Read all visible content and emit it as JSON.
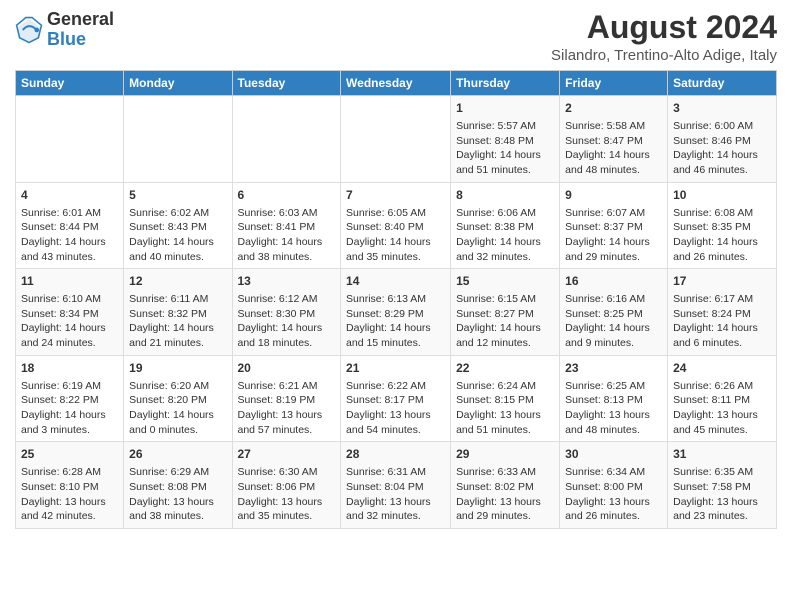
{
  "header": {
    "logo_line1": "General",
    "logo_line2": "Blue",
    "title": "August 2024",
    "subtitle": "Silandro, Trentino-Alto Adige, Italy"
  },
  "columns": [
    "Sunday",
    "Monday",
    "Tuesday",
    "Wednesday",
    "Thursday",
    "Friday",
    "Saturday"
  ],
  "weeks": [
    [
      {
        "day": "",
        "content": ""
      },
      {
        "day": "",
        "content": ""
      },
      {
        "day": "",
        "content": ""
      },
      {
        "day": "",
        "content": ""
      },
      {
        "day": "1",
        "content": "Sunrise: 5:57 AM\nSunset: 8:48 PM\nDaylight: 14 hours and 51 minutes."
      },
      {
        "day": "2",
        "content": "Sunrise: 5:58 AM\nSunset: 8:47 PM\nDaylight: 14 hours and 48 minutes."
      },
      {
        "day": "3",
        "content": "Sunrise: 6:00 AM\nSunset: 8:46 PM\nDaylight: 14 hours and 46 minutes."
      }
    ],
    [
      {
        "day": "4",
        "content": "Sunrise: 6:01 AM\nSunset: 8:44 PM\nDaylight: 14 hours and 43 minutes."
      },
      {
        "day": "5",
        "content": "Sunrise: 6:02 AM\nSunset: 8:43 PM\nDaylight: 14 hours and 40 minutes."
      },
      {
        "day": "6",
        "content": "Sunrise: 6:03 AM\nSunset: 8:41 PM\nDaylight: 14 hours and 38 minutes."
      },
      {
        "day": "7",
        "content": "Sunrise: 6:05 AM\nSunset: 8:40 PM\nDaylight: 14 hours and 35 minutes."
      },
      {
        "day": "8",
        "content": "Sunrise: 6:06 AM\nSunset: 8:38 PM\nDaylight: 14 hours and 32 minutes."
      },
      {
        "day": "9",
        "content": "Sunrise: 6:07 AM\nSunset: 8:37 PM\nDaylight: 14 hours and 29 minutes."
      },
      {
        "day": "10",
        "content": "Sunrise: 6:08 AM\nSunset: 8:35 PM\nDaylight: 14 hours and 26 minutes."
      }
    ],
    [
      {
        "day": "11",
        "content": "Sunrise: 6:10 AM\nSunset: 8:34 PM\nDaylight: 14 hours and 24 minutes."
      },
      {
        "day": "12",
        "content": "Sunrise: 6:11 AM\nSunset: 8:32 PM\nDaylight: 14 hours and 21 minutes."
      },
      {
        "day": "13",
        "content": "Sunrise: 6:12 AM\nSunset: 8:30 PM\nDaylight: 14 hours and 18 minutes."
      },
      {
        "day": "14",
        "content": "Sunrise: 6:13 AM\nSunset: 8:29 PM\nDaylight: 14 hours and 15 minutes."
      },
      {
        "day": "15",
        "content": "Sunrise: 6:15 AM\nSunset: 8:27 PM\nDaylight: 14 hours and 12 minutes."
      },
      {
        "day": "16",
        "content": "Sunrise: 6:16 AM\nSunset: 8:25 PM\nDaylight: 14 hours and 9 minutes."
      },
      {
        "day": "17",
        "content": "Sunrise: 6:17 AM\nSunset: 8:24 PM\nDaylight: 14 hours and 6 minutes."
      }
    ],
    [
      {
        "day": "18",
        "content": "Sunrise: 6:19 AM\nSunset: 8:22 PM\nDaylight: 14 hours and 3 minutes."
      },
      {
        "day": "19",
        "content": "Sunrise: 6:20 AM\nSunset: 8:20 PM\nDaylight: 14 hours and 0 minutes."
      },
      {
        "day": "20",
        "content": "Sunrise: 6:21 AM\nSunset: 8:19 PM\nDaylight: 13 hours and 57 minutes."
      },
      {
        "day": "21",
        "content": "Sunrise: 6:22 AM\nSunset: 8:17 PM\nDaylight: 13 hours and 54 minutes."
      },
      {
        "day": "22",
        "content": "Sunrise: 6:24 AM\nSunset: 8:15 PM\nDaylight: 13 hours and 51 minutes."
      },
      {
        "day": "23",
        "content": "Sunrise: 6:25 AM\nSunset: 8:13 PM\nDaylight: 13 hours and 48 minutes."
      },
      {
        "day": "24",
        "content": "Sunrise: 6:26 AM\nSunset: 8:11 PM\nDaylight: 13 hours and 45 minutes."
      }
    ],
    [
      {
        "day": "25",
        "content": "Sunrise: 6:28 AM\nSunset: 8:10 PM\nDaylight: 13 hours and 42 minutes."
      },
      {
        "day": "26",
        "content": "Sunrise: 6:29 AM\nSunset: 8:08 PM\nDaylight: 13 hours and 38 minutes."
      },
      {
        "day": "27",
        "content": "Sunrise: 6:30 AM\nSunset: 8:06 PM\nDaylight: 13 hours and 35 minutes."
      },
      {
        "day": "28",
        "content": "Sunrise: 6:31 AM\nSunset: 8:04 PM\nDaylight: 13 hours and 32 minutes."
      },
      {
        "day": "29",
        "content": "Sunrise: 6:33 AM\nSunset: 8:02 PM\nDaylight: 13 hours and 29 minutes."
      },
      {
        "day": "30",
        "content": "Sunrise: 6:34 AM\nSunset: 8:00 PM\nDaylight: 13 hours and 26 minutes."
      },
      {
        "day": "31",
        "content": "Sunrise: 6:35 AM\nSunset: 7:58 PM\nDaylight: 13 hours and 23 minutes."
      }
    ]
  ]
}
